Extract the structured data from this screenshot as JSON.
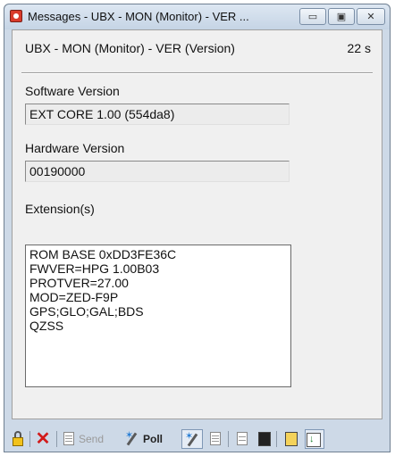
{
  "window": {
    "title": "Messages - UBX - MON (Monitor) - VER ...",
    "controls": {
      "minimize": "▭",
      "maximize": "▣",
      "close": "✕"
    }
  },
  "message": {
    "name": "UBX - MON (Monitor) - VER (Version)",
    "age": "22 s"
  },
  "software": {
    "label": "Software Version",
    "value": "EXT CORE 1.00 (554da8)"
  },
  "hardware": {
    "label": "Hardware Version",
    "value": "00190000"
  },
  "extensions": {
    "label": "Extension(s)",
    "lines": [
      "ROM BASE 0xDD3FE36C",
      "FWVER=HPG 1.00B03",
      "PROTVER=27.00",
      "MOD=ZED-F9P",
      "GPS;GLO;GAL;BDS",
      "QZSS"
    ]
  },
  "toolbar": {
    "send_label": "Send",
    "poll_label": "Poll",
    "icons": [
      "lock-icon",
      "delete-icon",
      "send-doc-icon",
      "poll-icon",
      "wand-icon",
      "list-icon",
      "copy-icon",
      "save-icon",
      "open-icon",
      "autoscroll-icon"
    ]
  },
  "colors": {
    "frame": "#cdd9e7",
    "client_bg": "#f0f0f0",
    "delete_red": "#d21a1a"
  }
}
